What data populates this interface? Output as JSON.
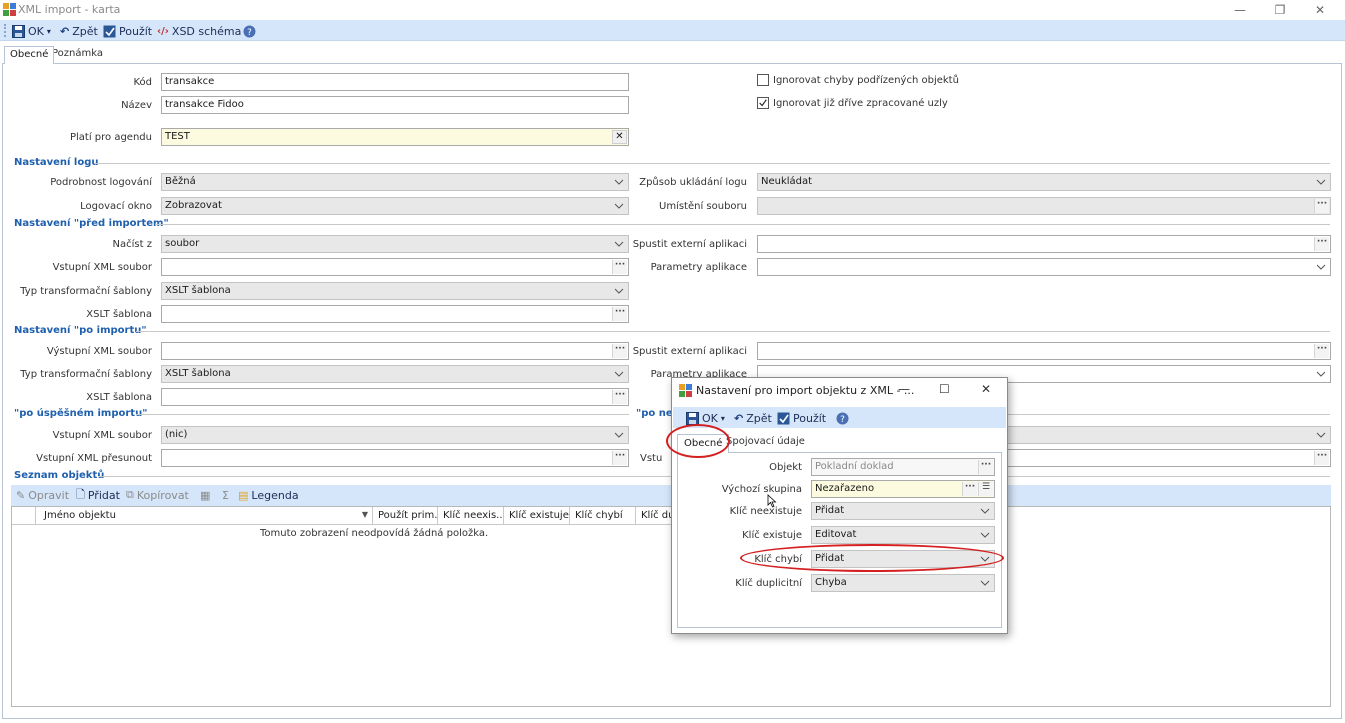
{
  "window": {
    "title": "XML import - karta",
    "controls": [
      "—",
      "❐",
      "✕"
    ]
  },
  "toolbar": {
    "ok": "OK",
    "back": "Zpět",
    "apply": "Použít",
    "xsd": "XSD schéma"
  },
  "tabs": {
    "general": "Obecné",
    "note": "Poznámka"
  },
  "form": {
    "kod_label": "Kód",
    "kod_value": "transakce",
    "nazev_label": "Název",
    "nazev_value": "transakce Fidoo",
    "agenda_label": "Platí pro agendu",
    "agenda_value": "TEST",
    "chk_ignore_child_errors": "Ignorovat chyby podřízených objektů",
    "chk_ignore_processed": "Ignorovat již dříve zpracované uzly"
  },
  "log": {
    "section": "Nastavení logu",
    "detail_label": "Podrobnost logování",
    "detail_value": "Běžná",
    "window_label": "Logovací okno",
    "window_value": "Zobrazovat",
    "save_label": "Způsob ukládání logu",
    "save_value": "Neukládat",
    "file_label": "Umístění souboru"
  },
  "pre": {
    "section": "Nastavení \"před importem\"",
    "load_label": "Načíst z",
    "load_value": "soubor",
    "input_xml_label": "Vstupní XML soubor",
    "transform_label": "Typ transformační šablony",
    "transform_value": "XSLT šablona",
    "xslt_label": "XSLT šablona",
    "ext_app_label": "Spustit externí aplikaci",
    "app_params_label": "Parametry aplikace"
  },
  "post": {
    "section": "Nastavení \"po importu\"",
    "output_xml_label": "Výstupní XML soubor",
    "transform_label": "Typ transformační šablony",
    "transform_value": "XSLT šablona",
    "xslt_label": "XSLT šablona",
    "ext_app_label": "Spustit externí aplikaci",
    "app_params_label": "Parametry aplikace"
  },
  "success": {
    "section": "\"po úspěšném importu\"",
    "input_xml_label": "Vstupní XML soubor",
    "input_xml_value": "(nic)",
    "move_label": "Vstupní XML přesunout"
  },
  "fail": {
    "section_partial": "\"po neú",
    "input_partial": "Vstu"
  },
  "objects": {
    "section": "Seznam objektů",
    "edit": "Opravit",
    "add": "Přidat",
    "copy": "Kopírovat",
    "sum": "Σ",
    "legend": "Legenda",
    "columns": [
      "Jméno objektu",
      "Použít prim...",
      "Klíč neexis...",
      "Klíč existuje",
      "Klíč chybí",
      "Klíč du"
    ],
    "empty": "Tomuto zobrazení neodpovídá žádná položka."
  },
  "dialog": {
    "title": "Nastavení pro import objektu z XML - ...",
    "controls": [
      "—",
      "☐",
      "✕"
    ],
    "toolbar": {
      "ok": "OK",
      "back": "Zpět",
      "apply": "Použít"
    },
    "tabs": {
      "general": "Obecné",
      "linking": "Spojovací údaje"
    },
    "object_label": "Objekt",
    "object_value": "Pokladní doklad",
    "group_label": "Výchozí skupina",
    "group_value": "Nezařazeno",
    "key_not_exist_label": "Klíč neexistuje",
    "key_not_exist_value": "Přidat",
    "key_exists_label": "Klíč existuje",
    "key_exists_value": "Editovat",
    "key_missing_label": "Klíč chybí",
    "key_missing_value": "Přidat",
    "key_duplicate_label": "Klíč duplicitní",
    "key_duplicate_value": "Chyba"
  },
  "colors": {
    "accent": "#1f5fad",
    "toolbar_bg": "#d6e6fa",
    "highlight_ring": "#d42020",
    "yellow_field": "#fdfbdf"
  }
}
